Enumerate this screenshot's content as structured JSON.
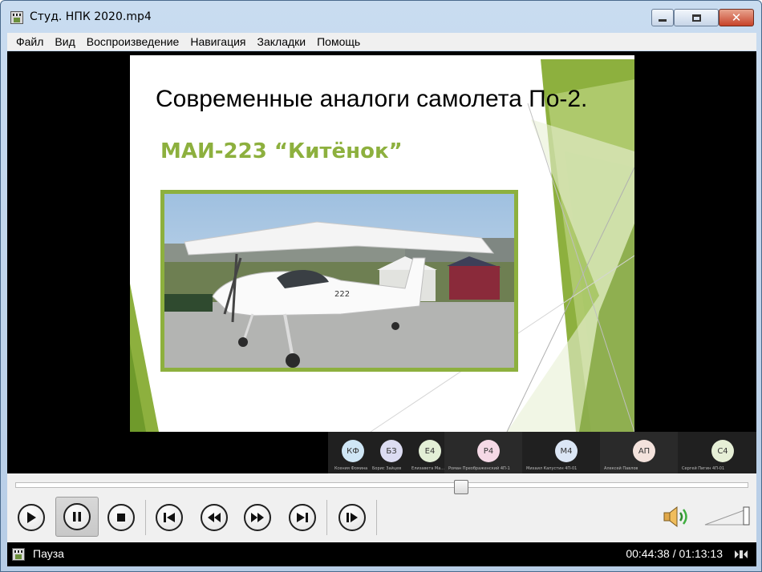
{
  "window": {
    "title": "Студ. НПК 2020.mp4"
  },
  "menu": {
    "items": [
      "Файл",
      "Вид",
      "Воспроизведение",
      "Навигация",
      "Закладки",
      "Помощь"
    ]
  },
  "slide": {
    "title": "Современные аналоги самолета По-2.",
    "subtitle": "МАИ-223 “Китёнок”",
    "accent_color": "#8db03e"
  },
  "participants": [
    {
      "initials": "КФ",
      "name": "Ксения Фомина",
      "avatar_color": "#cfe6f5"
    },
    {
      "initials": "БЗ",
      "name": "Борис Зайцев",
      "avatar_color": "#dcdcf2"
    },
    {
      "initials": "Е4",
      "name": "Елизавета Ма...",
      "avatar_color": "#e3efd6"
    },
    {
      "initials": "Р4",
      "name": "Роман Преображенский 4П-1",
      "avatar_color": "#f5d9e6"
    },
    {
      "initials": "М4",
      "name": "Михаил Капустин 4П-01",
      "avatar_color": "#dbe6f5"
    },
    {
      "initials": "АП",
      "name": "Алексей Павлов",
      "avatar_color": "#f3e2dc"
    },
    {
      "initials": "С4",
      "name": "Сергей Пигин 4П-01",
      "avatar_color": "#e6efd6"
    }
  ],
  "playback": {
    "progress": 0.608,
    "volume": 1.0
  },
  "controls": {
    "icons": [
      "play-icon",
      "pause-icon",
      "stop-icon",
      "skip-previous-icon",
      "rewind-icon",
      "fast-forward-icon",
      "skip-next-icon",
      "frame-step-icon",
      "volume-icon"
    ]
  },
  "status": {
    "state": "Пауза",
    "time": "00:44:38 / 01:13:13"
  }
}
